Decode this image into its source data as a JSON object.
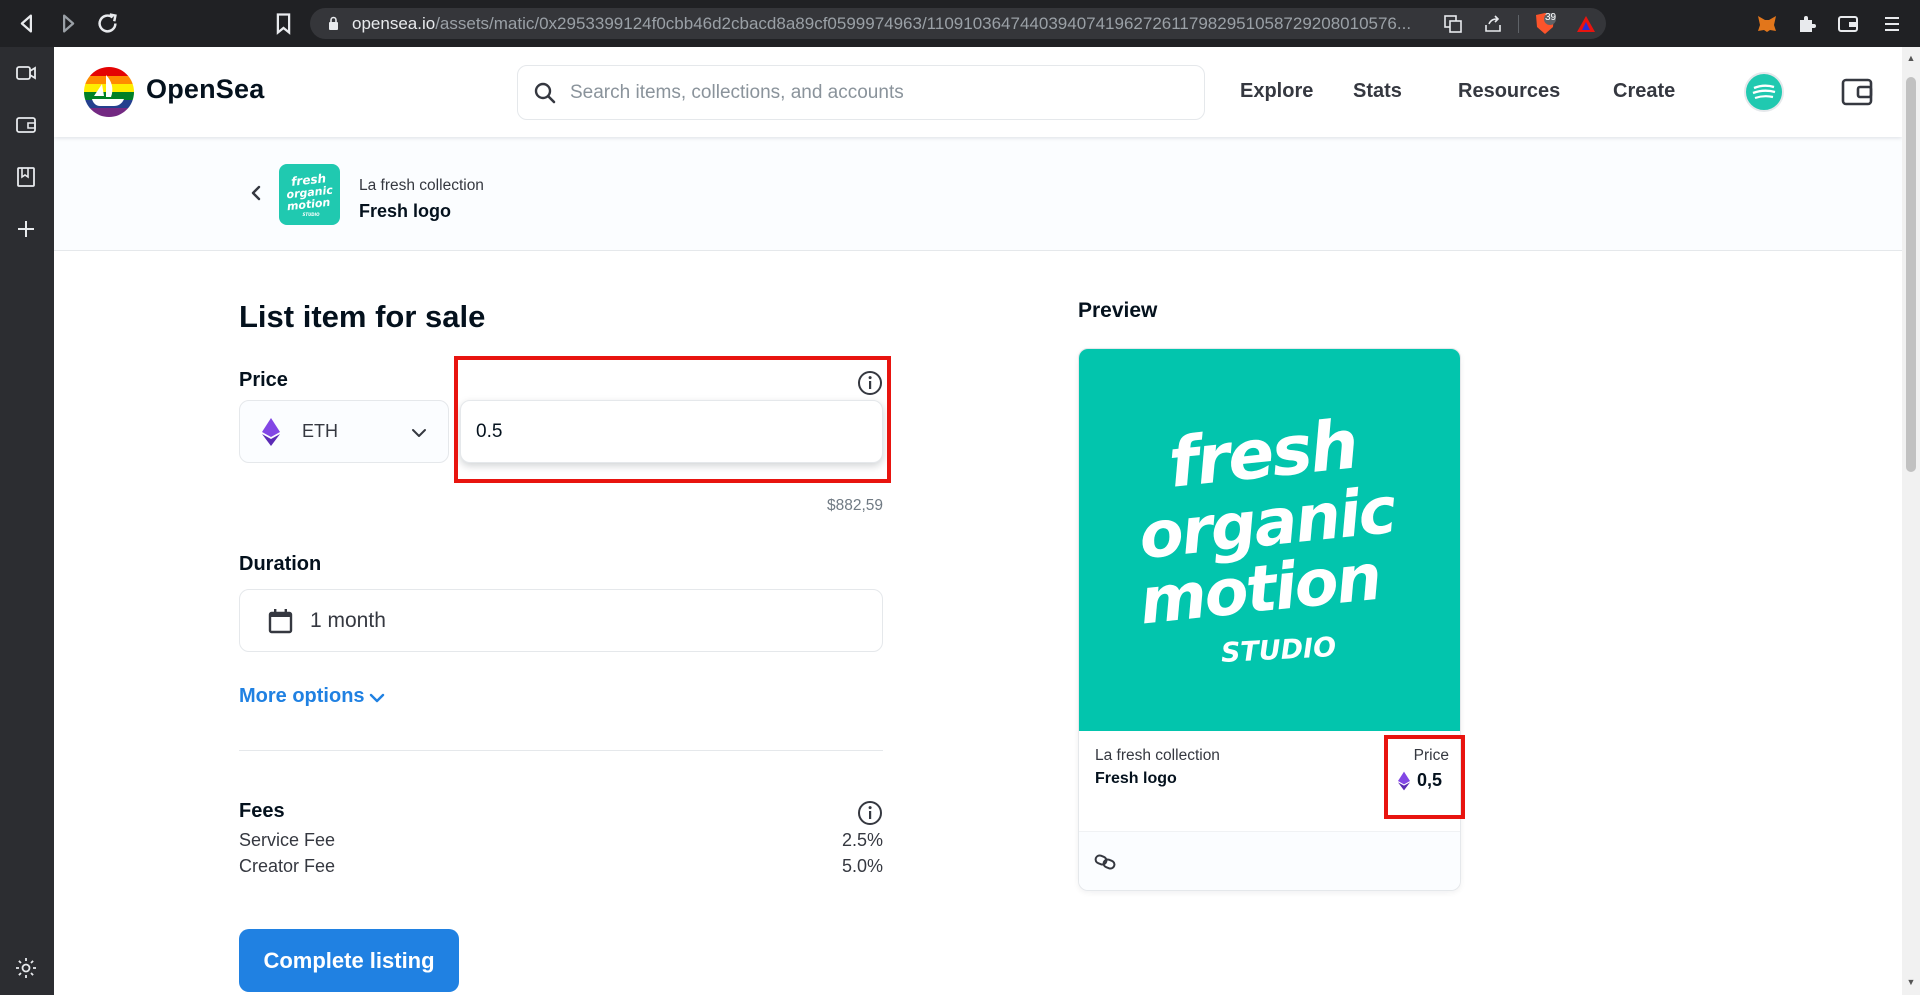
{
  "browser": {
    "url_host": "opensea.io",
    "url_path": "/assets/matic/0x2953399124f0cbb46d2cbacd8a89cf0599974963/11091036474403940741962726117982951058729208010576...",
    "shield_count": "39"
  },
  "header": {
    "logo_text": "OpenSea",
    "search_placeholder": "Search items, collections, and accounts",
    "nav": [
      "Explore",
      "Stats",
      "Resources",
      "Create"
    ]
  },
  "collection_bar": {
    "collection_name": "La fresh collection",
    "item_name": "Fresh logo",
    "thumb_text": [
      "fresh",
      "organic",
      "motion",
      "STUDIO"
    ]
  },
  "form": {
    "title": "List item for sale",
    "price_label": "Price",
    "currency": "ETH",
    "price_value": "0.5",
    "usd_value": "$882,59",
    "duration_label": "Duration",
    "duration_value": "1 month",
    "more_options": "More options",
    "fees_label": "Fees",
    "fees": [
      {
        "name": "Service Fee",
        "value": "2.5%"
      },
      {
        "name": "Creator Fee",
        "value": "5.0%"
      }
    ],
    "complete_button": "Complete listing"
  },
  "preview": {
    "label": "Preview",
    "image_text": [
      "fresh",
      "organic",
      "motion",
      "STUDIO"
    ],
    "collection_name": "La fresh collection",
    "item_name": "Fresh logo",
    "price_label": "Price",
    "price_value": "0,5"
  },
  "colors": {
    "accent": "#2081e2",
    "highlight": "#e8140f",
    "brand_teal": "#02c5ad",
    "eth_purple": "#8247e5"
  }
}
